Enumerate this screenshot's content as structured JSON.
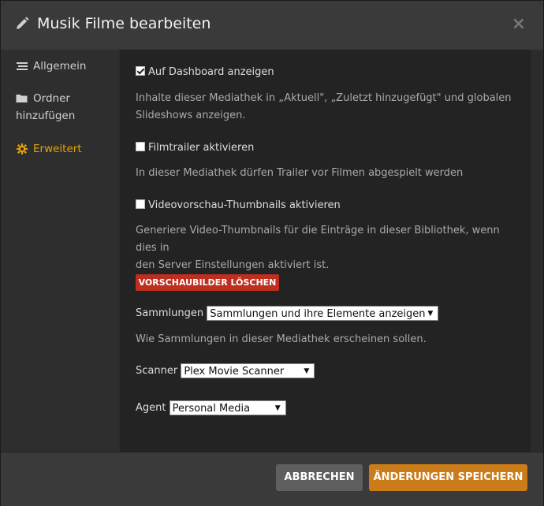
{
  "header": {
    "title": "Musik Filme bearbeiten",
    "close_symbol": "×"
  },
  "sidebar": {
    "items": [
      {
        "label": "Allgemein",
        "icon": "list-icon"
      },
      {
        "label_line1": "Ordner",
        "label_line2": "hinzufügen",
        "icon": "folder-icon"
      },
      {
        "label": "Erweitert",
        "icon": "gear-icon",
        "active": true
      }
    ]
  },
  "content": {
    "dashboard": {
      "label": "Auf Dashboard anzeigen",
      "checked": true,
      "desc_line1": "Inhalte dieser Mediathek in „Aktuell\", „Zuletzt hinzugefügt\" und globalen",
      "desc_line2": "Slideshows anzeigen."
    },
    "trailer": {
      "label": "Filmtrailer aktivieren",
      "checked": false,
      "desc": "In dieser Mediathek dürfen Trailer vor Filmen abgespielt werden"
    },
    "thumbnails": {
      "label": "Videovorschau-Thumbnails aktivieren",
      "checked": false,
      "desc_line1": "Generiere Video-Thumbnails für die Einträge in dieser Bibliothek, wenn dies in",
      "desc_line2": "den Server Einstellungen aktiviert ist."
    },
    "delete_previews_button": "VORSCHAUBILDER LÖSCHEN",
    "collections": {
      "label": "Sammlungen",
      "value": "Sammlungen und ihre Elemente anzeigen",
      "desc": "Wie Sammlungen in dieser Mediathek erscheinen sollen."
    },
    "scanner": {
      "label": "Scanner",
      "value": "Plex Movie Scanner"
    },
    "agent": {
      "label": "Agent",
      "value": "Personal Media"
    }
  },
  "footer": {
    "cancel_label": "ABBRECHEN",
    "save_label": "ÄNDERUNGEN SPEICHERN"
  },
  "colors": {
    "accent": "#e5a00d",
    "danger": "#bf2f1f",
    "save": "#cc7b19"
  }
}
